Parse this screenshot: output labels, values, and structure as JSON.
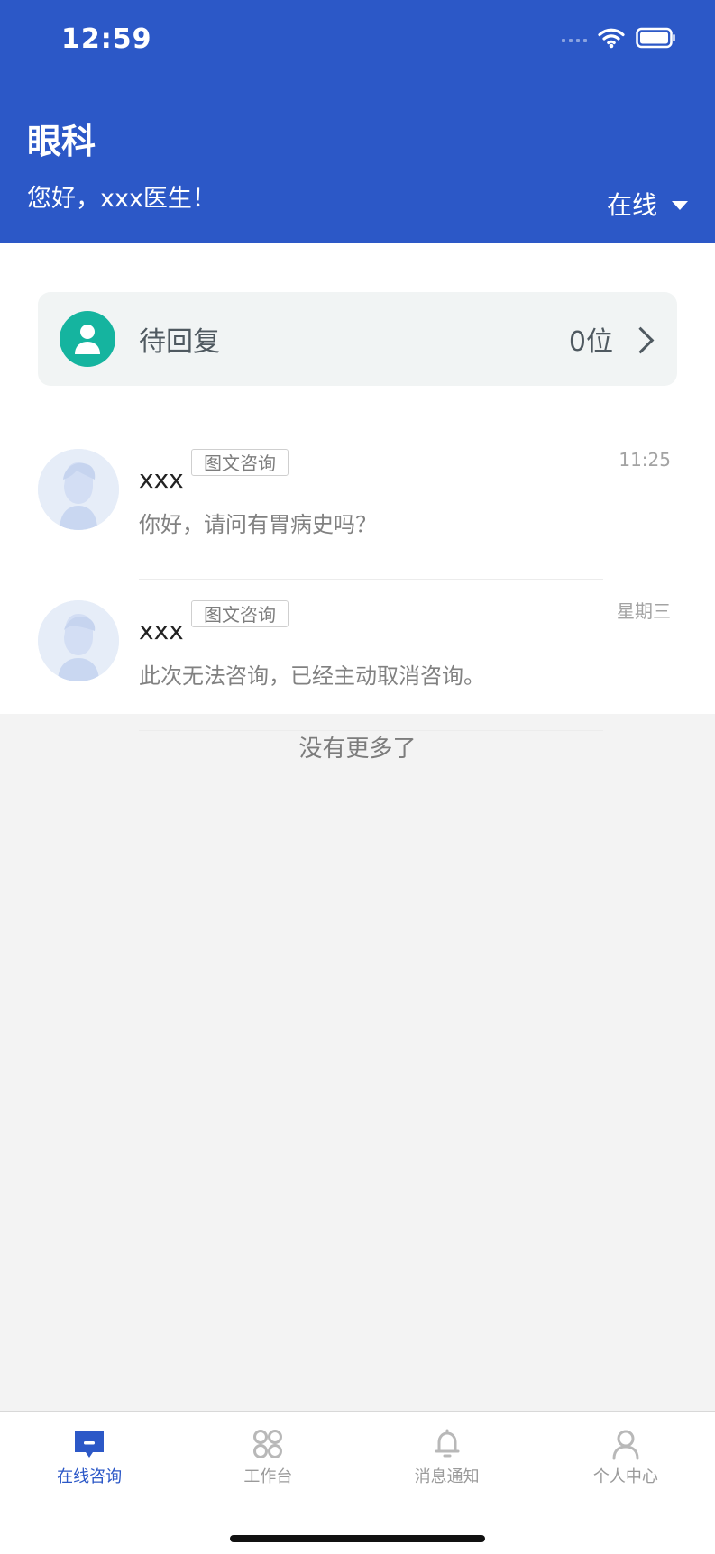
{
  "status_bar": {
    "time": "12:59"
  },
  "header": {
    "title": "眼科",
    "greeting": "您好，xxx医生！",
    "status": "在线"
  },
  "pending": {
    "label": "待回复",
    "count": "0位"
  },
  "chats": [
    {
      "name": "xxx",
      "tag": "图文咨询",
      "time": "11:25",
      "message": "你好，请问有胃病史吗？"
    },
    {
      "name": "xxx",
      "tag": "图文咨询",
      "time": "星期三",
      "message": "此次无法咨询，已经主动取消咨询。"
    }
  ],
  "footer_text": "没有更多了",
  "tabs": [
    {
      "label": "在线咨询",
      "icon": "chat-icon",
      "active": true
    },
    {
      "label": "工作台",
      "icon": "grid-icon",
      "active": false
    },
    {
      "label": "消息通知",
      "icon": "bell-icon",
      "active": false
    },
    {
      "label": "个人中心",
      "icon": "user-icon",
      "active": false
    }
  ],
  "colors": {
    "header": "#2c58c7",
    "accent": "#2c58c7",
    "pending_avatar": "#15b49f"
  }
}
